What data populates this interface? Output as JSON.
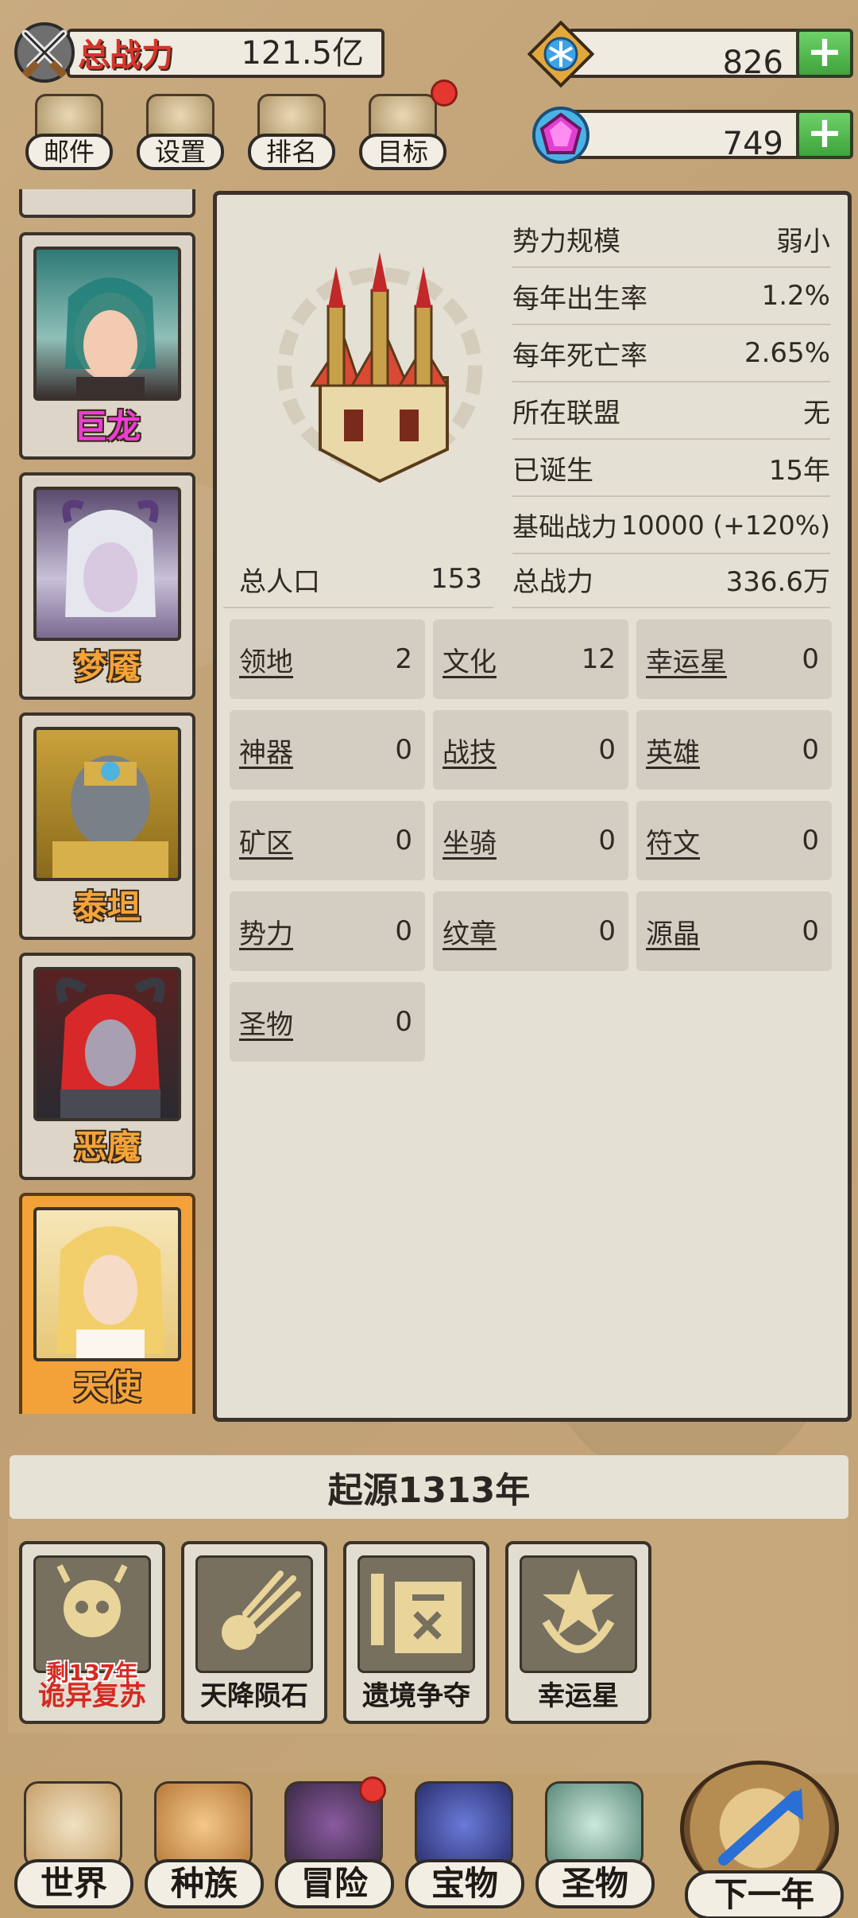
{
  "header": {
    "total_power_label": "总战力",
    "total_power_value": "121.5亿"
  },
  "currency": [
    {
      "icon": "snowflake-gem-icon",
      "value": "826",
      "add": "+"
    },
    {
      "icon": "pink-crystal-icon",
      "value": "749",
      "add": "+"
    }
  ],
  "quick_buttons": [
    {
      "label": "邮件",
      "icon": "mail-icon"
    },
    {
      "label": "设置",
      "icon": "gear-icon"
    },
    {
      "label": "排名",
      "icon": "podium-icon"
    },
    {
      "label": "目标",
      "icon": "scroll-icon"
    }
  ],
  "races": [
    {
      "name": "巨龙",
      "color": "#f03bd9"
    },
    {
      "name": "梦魇",
      "color": "#f4a43a"
    },
    {
      "name": "泰坦",
      "color": "#f4a43a"
    },
    {
      "name": "恶魔",
      "color": "#f4a43a"
    },
    {
      "name": "天使",
      "color": "#f4a43a"
    }
  ],
  "stats": [
    {
      "label": "势力规模",
      "value": "弱小"
    },
    {
      "label": "每年出生率",
      "value": "1.2%"
    },
    {
      "label": "每年死亡率",
      "value": "2.65%"
    },
    {
      "label": "所在联盟",
      "value": "无"
    },
    {
      "label": "已诞生",
      "value": "15年"
    },
    {
      "label": "基础战力",
      "value": "10000 (+120%)"
    }
  ],
  "population": {
    "label": "总人口",
    "value": "153"
  },
  "total": {
    "label": "总战力",
    "value": "336.6万"
  },
  "grid": [
    {
      "label": "领地",
      "value": "2"
    },
    {
      "label": "文化",
      "value": "12"
    },
    {
      "label": "幸运星",
      "value": "0"
    },
    {
      "label": "神器",
      "value": "0"
    },
    {
      "label": "战技",
      "value": "0"
    },
    {
      "label": "英雄",
      "value": "0"
    },
    {
      "label": "矿区",
      "value": "0"
    },
    {
      "label": "坐骑",
      "value": "0"
    },
    {
      "label": "符文",
      "value": "0"
    },
    {
      "label": "势力",
      "value": "0"
    },
    {
      "label": "纹章",
      "value": "0"
    },
    {
      "label": "源晶",
      "value": "0"
    },
    {
      "label": "圣物",
      "value": "0"
    }
  ],
  "year_banner": "起源1313年",
  "events": [
    {
      "label": "诡异复苏",
      "countdown": "剩137年",
      "icon": "skull-icon",
      "label_color": "#d52a22"
    },
    {
      "label": "天降陨石",
      "icon": "meteor-icon",
      "label_color": "#1e1a16"
    },
    {
      "label": "遗境争夺",
      "icon": "ruins-icon",
      "label_color": "#1e1a16"
    },
    {
      "label": "幸运星",
      "icon": "star-icon",
      "label_color": "#1e1a16"
    }
  ],
  "bottom_nav": [
    {
      "label": "世界",
      "icon": "map-icon"
    },
    {
      "label": "种族",
      "icon": "race-mask-icon"
    },
    {
      "label": "冒险",
      "icon": "adventure-icon"
    },
    {
      "label": "宝物",
      "icon": "treasure-chest-icon"
    },
    {
      "label": "圣物",
      "icon": "relic-icon"
    }
  ],
  "next_year": {
    "label": "下一年",
    "icon": "arrow-wheel-icon"
  }
}
